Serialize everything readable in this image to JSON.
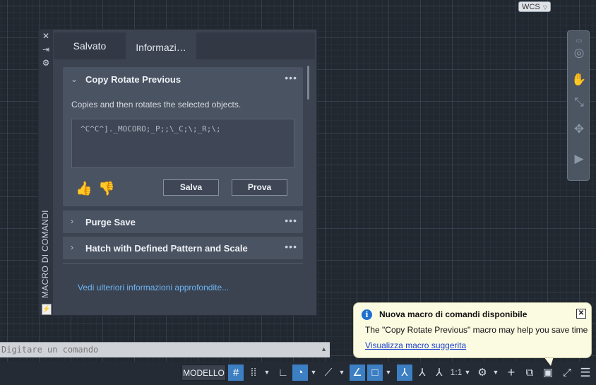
{
  "viewport": {
    "wcs_label": "WCS"
  },
  "palette": {
    "side_title": "MACRO DI COMANDI",
    "tabs": [
      {
        "label": "Salvato"
      },
      {
        "label": "Informazi…"
      }
    ],
    "cards": [
      {
        "title": "Copy Rotate Previous",
        "expanded": true,
        "description": "Copies and then rotates the selected objects.",
        "macro": "^C^C^]._MOCORO;_P;;\\_C;\\;_R;\\;",
        "buttons": {
          "save": "Salva",
          "try": "Prova"
        }
      },
      {
        "title": "Purge Save",
        "expanded": false
      },
      {
        "title": "Hatch with Defined Pattern and Scale",
        "expanded": false
      }
    ],
    "more_link": "Vedi ulteriori informazioni approfondite..."
  },
  "command_line": {
    "placeholder": "Digitare un comando"
  },
  "status_bar": {
    "model_label": "MODELLO",
    "scale_label": "1:1"
  },
  "notification": {
    "title": "Nuova macro di comandi disponibile",
    "body": "The \"Copy Rotate Previous\" macro may help you save time",
    "link": "Visualizza macro suggerita"
  }
}
